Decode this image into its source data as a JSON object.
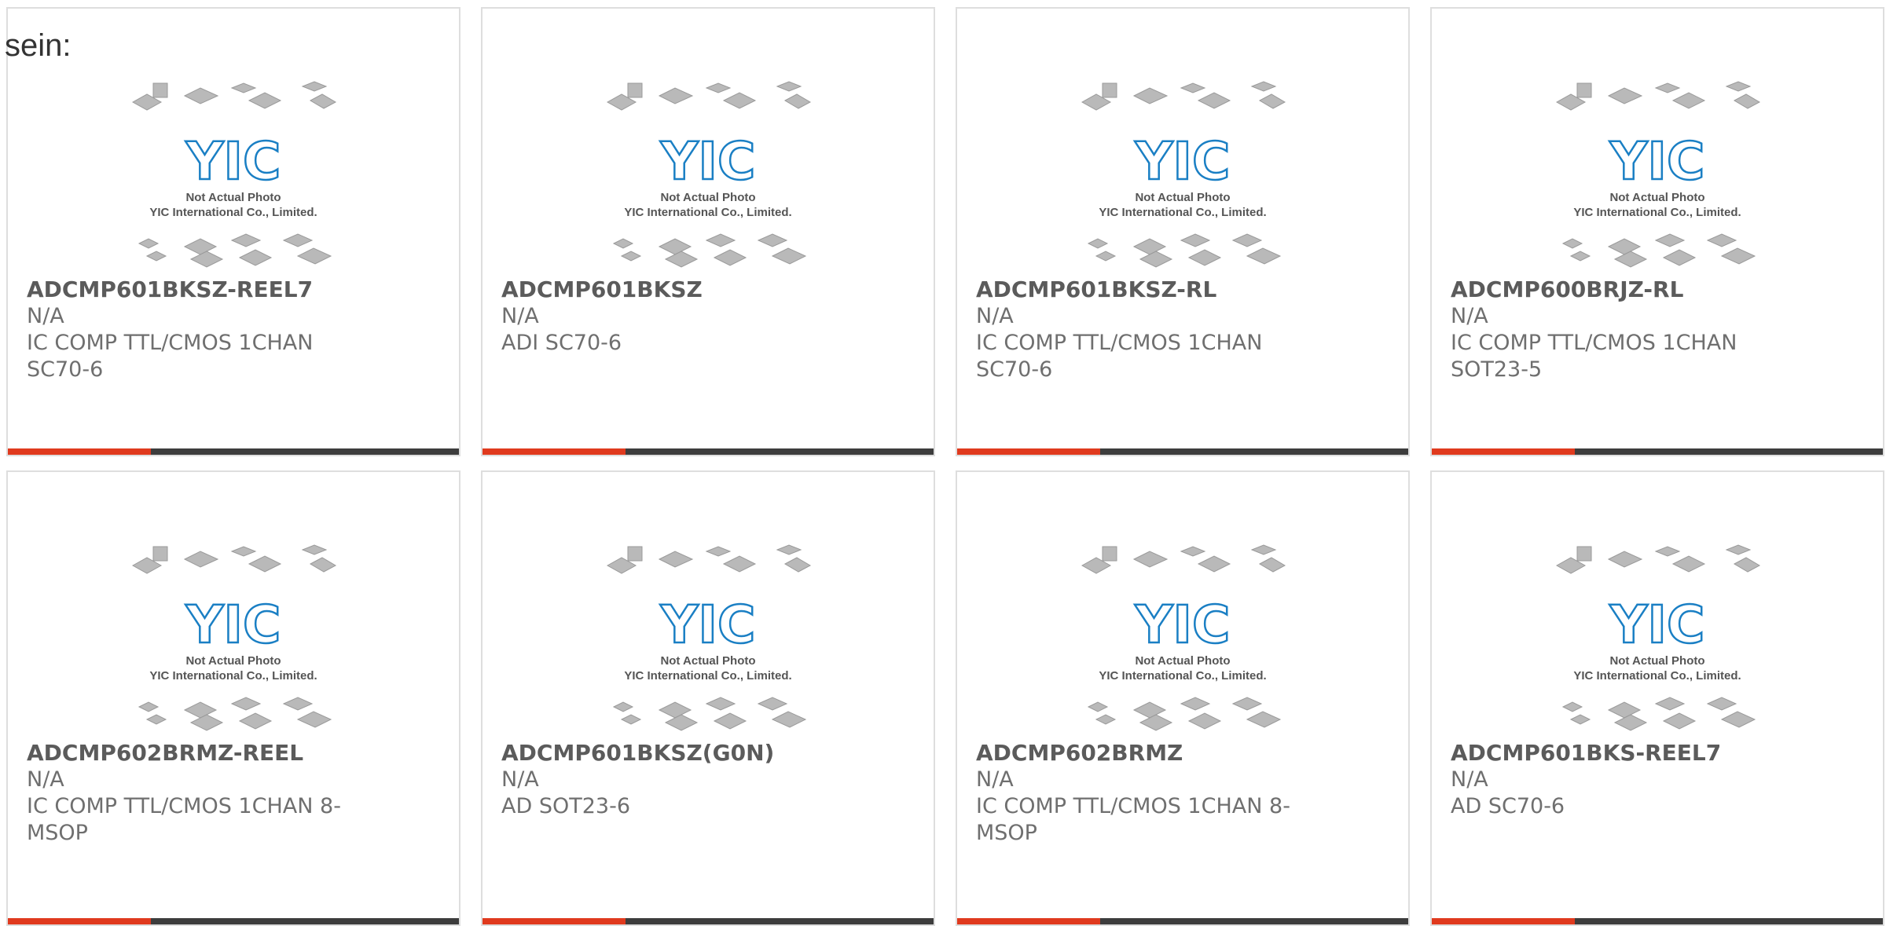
{
  "page": {
    "intro_text": "sein:"
  },
  "colors": {
    "accent": "#e03a1e",
    "bar": "#3d3d3d",
    "logo_blue": "#1a7fc4",
    "chip_gray": "#b9b9b9"
  },
  "placeholder_image": {
    "logo_text": "YIC",
    "caption_line1": "Not Actual Photo",
    "caption_line2": "YIC International Co., Limited."
  },
  "products": [
    {
      "part": "ADCMP601BKSZ-REEL7",
      "mfr": "N/A",
      "desc": "IC COMP TTL/CMOS 1CHAN SC70-6"
    },
    {
      "part": "ADCMP601BKSZ",
      "mfr": "N/A",
      "desc": "ADI SC70-6"
    },
    {
      "part": "ADCMP601BKSZ-RL",
      "mfr": "N/A",
      "desc": "IC COMP TTL/CMOS 1CHAN SC70-6"
    },
    {
      "part": "ADCMP600BRJZ-RL",
      "mfr": "N/A",
      "desc": "IC COMP TTL/CMOS 1CHAN SOT23-5"
    },
    {
      "part": "ADCMP602BRMZ-REEL",
      "mfr": "N/A",
      "desc": "IC COMP TTL/CMOS 1CHAN 8-MSOP"
    },
    {
      "part": "ADCMP601BKSZ(G0N)",
      "mfr": "N/A",
      "desc": "AD SOT23-6"
    },
    {
      "part": "ADCMP602BRMZ",
      "mfr": "N/A",
      "desc": "IC COMP TTL/CMOS 1CHAN 8-MSOP"
    },
    {
      "part": "ADCMP601BKS-REEL7",
      "mfr": "N/A",
      "desc": "AD SC70-6"
    }
  ]
}
